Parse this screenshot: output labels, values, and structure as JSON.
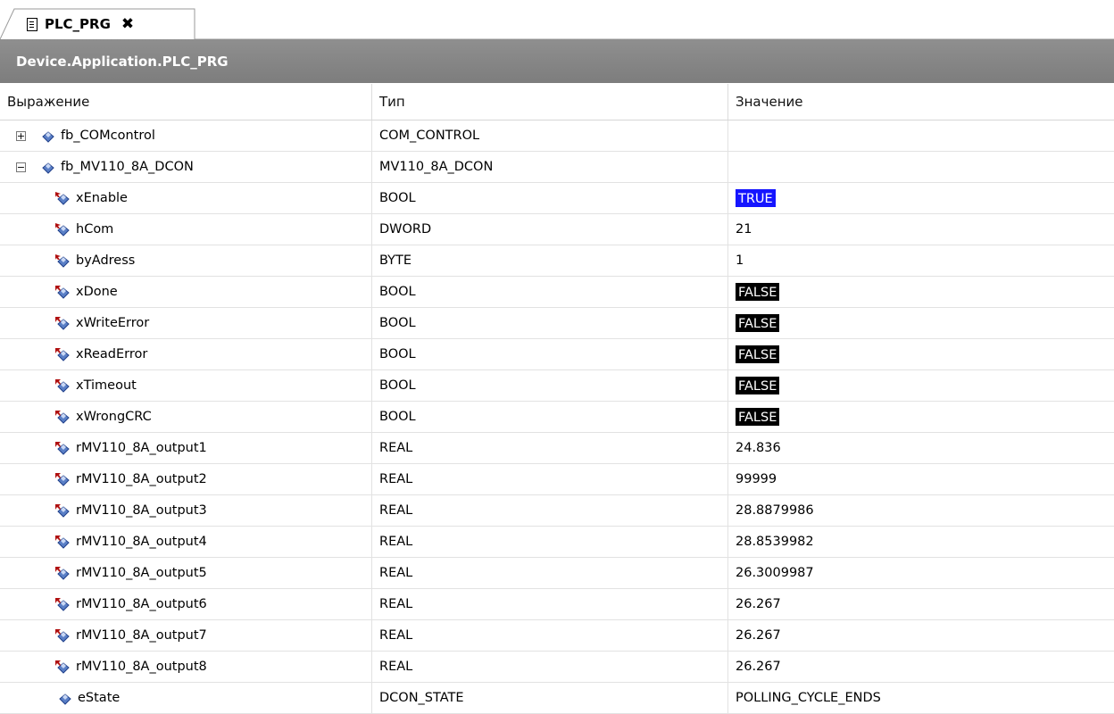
{
  "tab": {
    "label": "PLC_PRG",
    "close": "✖"
  },
  "title": "Device.Application.PLC_PRG",
  "columns": [
    "Выражение",
    "Тип",
    "Значение"
  ],
  "rows": [
    {
      "name": "fb_COMcontrol",
      "type": "COM_CONTROL",
      "value": "",
      "kind": "fb",
      "expander": "+"
    },
    {
      "name": "fb_MV110_8A_DCON",
      "type": "MV110_8A_DCON",
      "value": "",
      "kind": "fb",
      "expander": "−"
    },
    {
      "name": "xEnable",
      "type": "BOOL",
      "value": "TRUE",
      "kind": "input",
      "style": "true"
    },
    {
      "name": "hCom",
      "type": "DWORD",
      "value": "21",
      "kind": "input"
    },
    {
      "name": "byAdress",
      "type": "BYTE",
      "value": "1",
      "kind": "input"
    },
    {
      "name": "xDone",
      "type": "BOOL",
      "value": "FALSE",
      "kind": "output",
      "style": "false"
    },
    {
      "name": "xWriteError",
      "type": "BOOL",
      "value": "FALSE",
      "kind": "output",
      "style": "false"
    },
    {
      "name": "xReadError",
      "type": "BOOL",
      "value": "FALSE",
      "kind": "output",
      "style": "false"
    },
    {
      "name": "xTimeout",
      "type": "BOOL",
      "value": "FALSE",
      "kind": "output",
      "style": "false"
    },
    {
      "name": "xWrongCRC",
      "type": "BOOL",
      "value": "FALSE",
      "kind": "output",
      "style": "false"
    },
    {
      "name": "rMV110_8A_output1",
      "type": "REAL",
      "value": "24.836",
      "kind": "output"
    },
    {
      "name": "rMV110_8A_output2",
      "type": "REAL",
      "value": "99999",
      "kind": "output"
    },
    {
      "name": "rMV110_8A_output3",
      "type": "REAL",
      "value": "28.8879986",
      "kind": "output"
    },
    {
      "name": "rMV110_8A_output4",
      "type": "REAL",
      "value": "28.8539982",
      "kind": "output"
    },
    {
      "name": "rMV110_8A_output5",
      "type": "REAL",
      "value": "26.3009987",
      "kind": "output"
    },
    {
      "name": "rMV110_8A_output6",
      "type": "REAL",
      "value": "26.267",
      "kind": "output"
    },
    {
      "name": "rMV110_8A_output7",
      "type": "REAL",
      "value": "26.267",
      "kind": "output"
    },
    {
      "name": "rMV110_8A_output8",
      "type": "REAL",
      "value": "26.267",
      "kind": "output"
    },
    {
      "name": "eState",
      "type": "DCON_STATE",
      "value": "POLLING_CYCLE_ENDS",
      "kind": "local"
    }
  ],
  "colors": {
    "true_bg": "#1515ff",
    "false_bg": "#000000",
    "title_bg": "#858585"
  }
}
